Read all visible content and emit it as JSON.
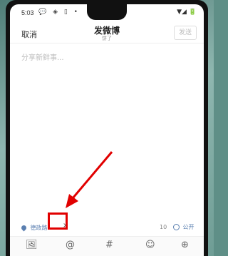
{
  "status": {
    "time": "5:03",
    "left_icons": "💬 ◈ ▯ •",
    "right_icons": "▼◢ 🔋"
  },
  "nav": {
    "cancel": "取消",
    "title": "发微博",
    "subtitle": "饼了",
    "send": "发送"
  },
  "editor": {
    "placeholder": "分享新鲜事..."
  },
  "bottom_bar": {
    "location": "德政路",
    "close": "×",
    "count": "10",
    "visibility": "公开"
  },
  "toolbar": {
    "icons": [
      "image-icon",
      "at-icon",
      "hashtag-icon",
      "emoji-icon",
      "add-icon"
    ],
    "glyphs": [
      "🖼",
      "@",
      "#",
      "☺",
      "⊕"
    ]
  },
  "colors": {
    "accent": "#5a7fb0",
    "highlight": "#e10000"
  }
}
